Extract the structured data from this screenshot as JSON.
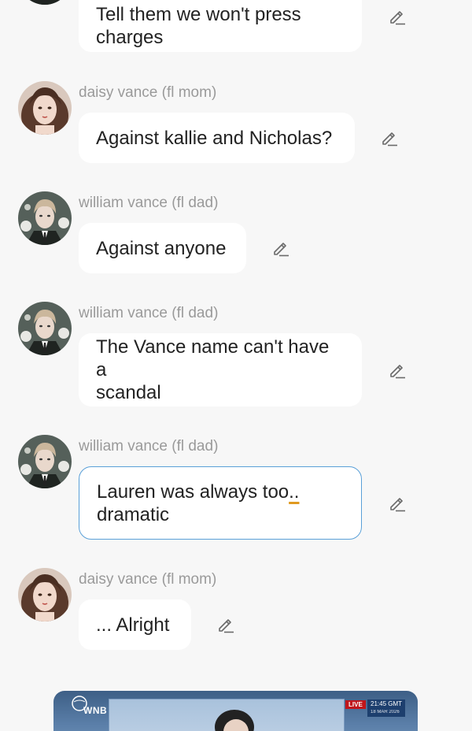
{
  "messages": [
    {
      "sender": "",
      "text": "Tell them we won't press charges",
      "line1": "Tell them we won't press",
      "line2": "charges"
    },
    {
      "sender": "daisy vance (fl mom)",
      "text": "Against kallie and Nicholas?"
    },
    {
      "sender": "william vance (fl dad)",
      "text": "Against anyone"
    },
    {
      "sender": "william vance (fl dad)",
      "text": "The Vance name can't have a scandal",
      "line1": "The Vance name can't have a",
      "line2": "scandal"
    },
    {
      "sender": "william vance (fl dad)",
      "text": "Lauren was always too.. dramatic",
      "line1a": "Lauren was always too",
      "line1b": "..",
      "line2": "dramatic"
    },
    {
      "sender": "daisy vance (fl mom)",
      "text": "... Alright"
    }
  ],
  "news_card": {
    "logo": "WNB",
    "live": "LIVE",
    "time": "21:45 GMT",
    "date": "18 MAR 2026"
  },
  "colors": {
    "background": "#f7f7f7",
    "bubble": "#ffffff",
    "selected_border": "#5aa0d8",
    "sender": "#9a9a9a",
    "text": "#222222"
  }
}
